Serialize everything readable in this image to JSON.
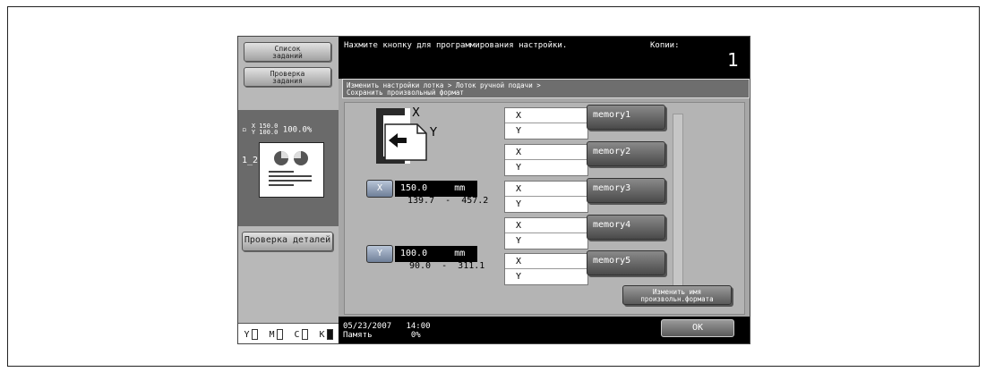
{
  "sidebar": {
    "job_list_label": "Список\nзаданий",
    "job_check_label": "Проверка\nзадания",
    "size_xy": "X 150.0\nY 100.0",
    "zoom": "100.0%",
    "pages_glyph": "1̲2",
    "detail_check_label": "Проверка деталей",
    "toner": [
      {
        "label": "Y",
        "color": "#ffffff"
      },
      {
        "label": "M",
        "color": "#ffffff"
      },
      {
        "label": "C",
        "color": "#ffffff"
      },
      {
        "label": "K",
        "color": "#111111"
      }
    ]
  },
  "header": {
    "message": "Нахмите кнопку для программирования настройки.",
    "copies_label": "Копии:",
    "copies_value": "1"
  },
  "breadcrumb": "Изменить настройки лотка > Лоток ручной подачи >\nСохранить произвольный формат",
  "size_input": {
    "x_button": "X",
    "x_value": "150.0     mm",
    "x_range": "139.7  -  457.2",
    "y_button": "Y",
    "y_value": "100.0     mm",
    "y_range": "90.0  -  311.1",
    "icon_x": "X",
    "icon_y": "Y"
  },
  "memories": [
    {
      "label": "memory1",
      "x": "X",
      "y": "Y"
    },
    {
      "label": "memory2",
      "x": "X",
      "y": "Y"
    },
    {
      "label": "memory3",
      "x": "X",
      "y": "Y"
    },
    {
      "label": "memory4",
      "x": "X",
      "y": "Y"
    },
    {
      "label": "memory5",
      "x": "X",
      "y": "Y"
    }
  ],
  "rename_label": "Изменить имя\nпроизвольн.формата",
  "footer": {
    "datetime": "05/23/2007   14:00\nПамять        0%",
    "ok_label": "OK"
  }
}
